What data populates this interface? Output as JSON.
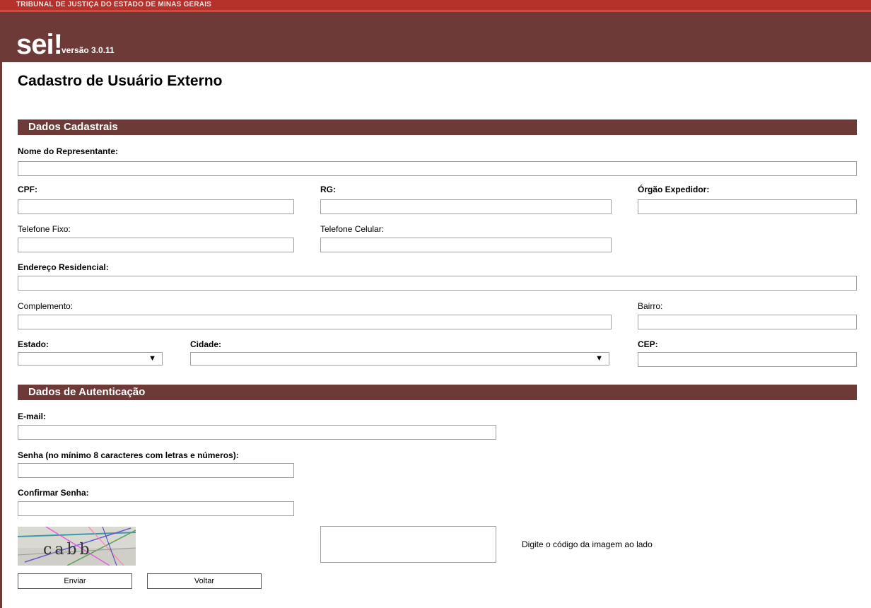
{
  "header": {
    "org_name": "TRIBUNAL DE JUSTIÇA DO ESTADO DE MINAS GERAIS",
    "logo_text": "sei",
    "logo_bang": "!",
    "version": "versão 3.0.11"
  },
  "page": {
    "title": "Cadastro de Usuário Externo"
  },
  "sections": {
    "cadastrais": "Dados Cadastrais",
    "autenticacao": "Dados de Autenticação"
  },
  "fields": {
    "nome": {
      "label": "Nome do Representante:",
      "value": ""
    },
    "cpf": {
      "label": "CPF:",
      "value": ""
    },
    "rg": {
      "label": "RG:",
      "value": ""
    },
    "orgao": {
      "label": "Órgão Expedidor:",
      "value": ""
    },
    "tel_fixo": {
      "label": "Telefone Fixo:",
      "value": ""
    },
    "tel_celular": {
      "label": "Telefone Celular:",
      "value": ""
    },
    "endereco": {
      "label": "Endereço Residencial:",
      "value": ""
    },
    "complemento": {
      "label": "Complemento:",
      "value": ""
    },
    "bairro": {
      "label": "Bairro:",
      "value": ""
    },
    "estado": {
      "label": "Estado:",
      "value": ""
    },
    "cidade": {
      "label": "Cidade:",
      "value": ""
    },
    "cep": {
      "label": "CEP:",
      "value": ""
    },
    "email": {
      "label": "E-mail:",
      "value": ""
    },
    "senha": {
      "label": "Senha (no mínimo 8 caracteres com letras e números):",
      "value": ""
    },
    "confirmar": {
      "label": "Confirmar Senha:",
      "value": ""
    },
    "captcha_code": {
      "value": ""
    }
  },
  "captcha": {
    "image_text": "cabb",
    "instruction": "Digite o código da imagem ao lado"
  },
  "buttons": {
    "enviar": "Enviar",
    "voltar": "Voltar"
  },
  "colors": {
    "header": "#6d3a38",
    "stripe": "#b5312c",
    "section": "#6d3a38"
  }
}
